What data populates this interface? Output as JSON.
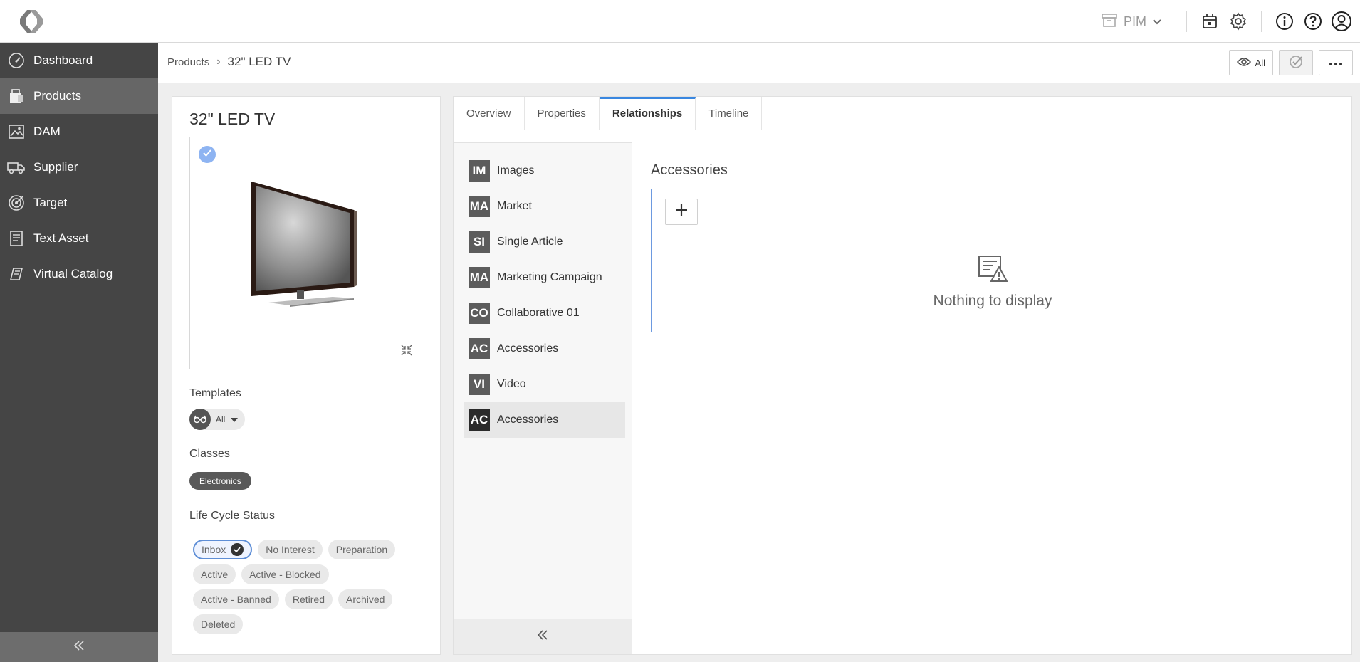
{
  "topbar": {
    "module_label": "PIM",
    "icons": [
      "logo-icon",
      "archive-icon",
      "chevron-down-icon",
      "calendar-icon",
      "gear-icon",
      "info-icon",
      "help-icon",
      "user-icon"
    ]
  },
  "sidebar": {
    "items": [
      {
        "label": "Dashboard",
        "icon": "gauge-icon"
      },
      {
        "label": "Products",
        "icon": "products-icon"
      },
      {
        "label": "DAM",
        "icon": "image-icon"
      },
      {
        "label": "Supplier",
        "icon": "truck-icon"
      },
      {
        "label": "Target",
        "icon": "target-icon"
      },
      {
        "label": "Text Asset",
        "icon": "document-icon"
      },
      {
        "label": "Virtual Catalog",
        "icon": "catalog-icon"
      }
    ],
    "active_index": 1
  },
  "breadcrumb": {
    "parent": "Products",
    "separator": "›",
    "current": "32\" LED TV"
  },
  "header_actions": {
    "view_label": "All"
  },
  "product": {
    "title": "32\" LED TV",
    "templates_label": "Templates",
    "templates_value": "All",
    "classes_label": "Classes",
    "classes": [
      "Electronics"
    ],
    "lifecycle_label": "Life Cycle Status",
    "lifecycle": [
      {
        "label": "Inbox",
        "selected": true
      },
      {
        "label": "No Interest",
        "selected": false
      },
      {
        "label": "Preparation",
        "selected": false
      },
      {
        "label": "Active",
        "selected": false
      },
      {
        "label": "Active - Blocked",
        "selected": false
      },
      {
        "label": "Active - Banned",
        "selected": false
      },
      {
        "label": "Retired",
        "selected": false
      },
      {
        "label": "Archived",
        "selected": false
      },
      {
        "label": "Deleted",
        "selected": false
      }
    ]
  },
  "tabs": [
    {
      "label": "Overview",
      "active": false
    },
    {
      "label": "Properties",
      "active": false
    },
    {
      "label": "Relationships",
      "active": true
    },
    {
      "label": "Timeline",
      "active": false
    }
  ],
  "relationships": {
    "items": [
      {
        "code": "IM",
        "label": "Images"
      },
      {
        "code": "MA",
        "label": "Market"
      },
      {
        "code": "SI",
        "label": "Single Article"
      },
      {
        "code": "MA",
        "label": "Marketing Campaign"
      },
      {
        "code": "CO",
        "label": "Collaborative 01"
      },
      {
        "code": "AC",
        "label": "Accessories"
      },
      {
        "code": "VI",
        "label": "Video"
      },
      {
        "code": "AC",
        "label": "Accessories"
      }
    ],
    "active_index": 7
  },
  "panel": {
    "title": "Accessories",
    "empty_text": "Nothing to display"
  }
}
